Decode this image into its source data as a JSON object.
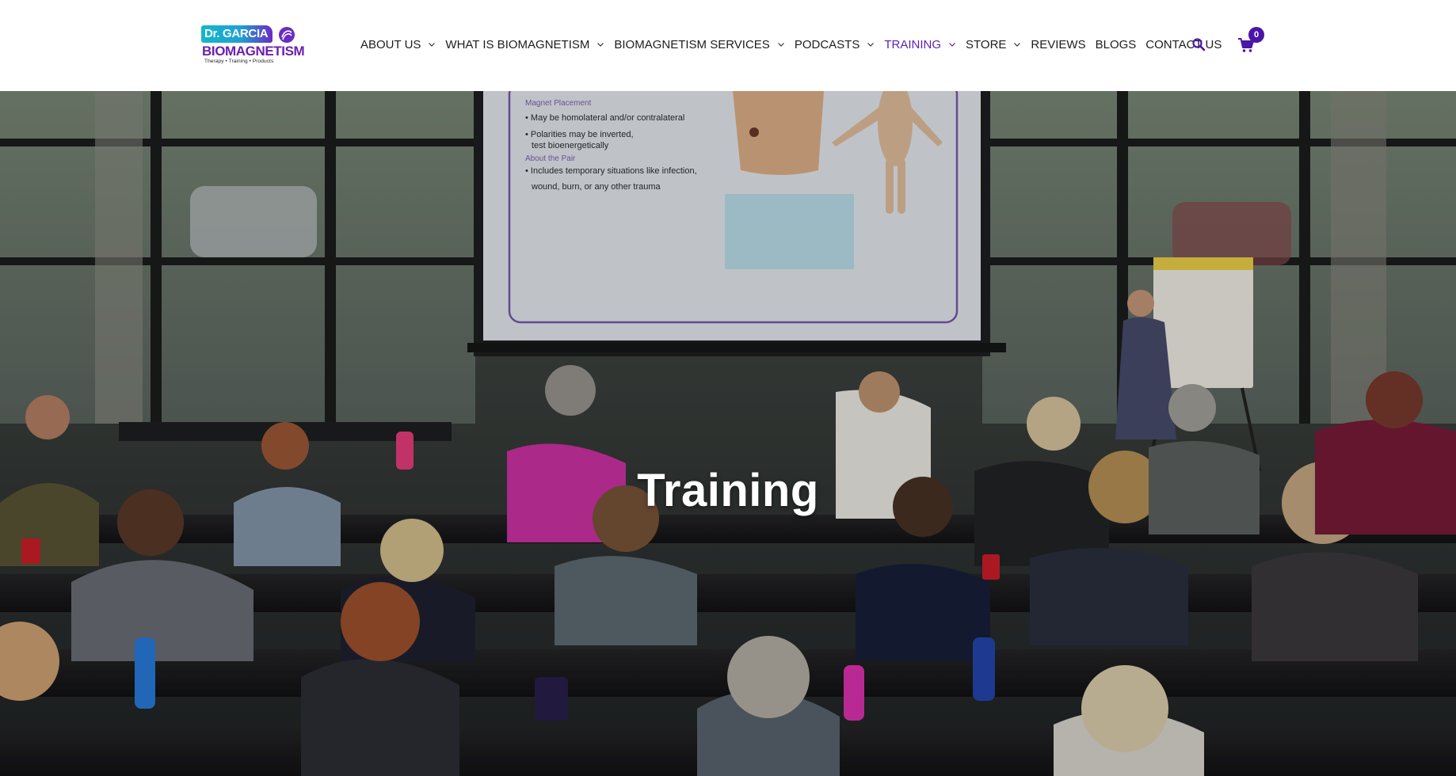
{
  "logo": {
    "badge_text": "Dr. GARCIA",
    "brand_text": "BIOMAGNETISM",
    "tagline": "Therapy • Training • Products"
  },
  "nav": {
    "items": [
      {
        "label": "ABOUT US",
        "has_dropdown": true
      },
      {
        "label": "WHAT IS BIOMAGNETISM",
        "has_dropdown": true
      },
      {
        "label": "BIOMAGNETISM SERVICES",
        "has_dropdown": true
      },
      {
        "label": "PODCASTS",
        "has_dropdown": true
      },
      {
        "label": "TRAINING",
        "has_dropdown": true,
        "active": true
      },
      {
        "label": "STORE",
        "has_dropdown": true
      },
      {
        "label": "REVIEWS",
        "has_dropdown": false
      },
      {
        "label": "BLOGS",
        "has_dropdown": false
      },
      {
        "label": "CONTACT US",
        "has_dropdown": false
      }
    ],
    "search_icon": "search-icon",
    "cart_icon": "cart-icon",
    "cart_count": "0"
  },
  "hero": {
    "title": "Training",
    "slide": {
      "heading": "Magnet Placement",
      "bullets": [
        "• May be homolateral and/or contralateral",
        "• Polarities may be inverted,",
        "test bioenergetically"
      ],
      "subheading": "About the Pair",
      "bullets2": [
        "• Includes temporary situations like infection,",
        "wound, burn, or any other trauma"
      ]
    }
  },
  "colors": {
    "accent": "#5a1fb8",
    "brand_purple": "#6b1fb0",
    "brand_teal": "#14b7c9",
    "cart_badge": "#4a14a8",
    "nav_text": "#1d1d1d"
  }
}
